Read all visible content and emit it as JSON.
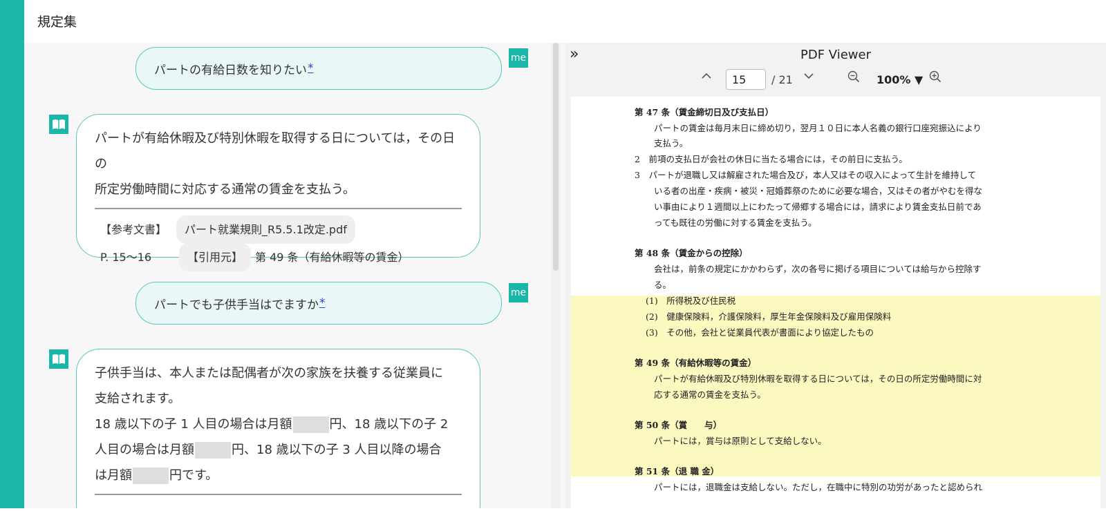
{
  "app": {
    "title": "規定集"
  },
  "chat": {
    "messages": [
      {
        "role": "user",
        "text": "パートの有給日数を知りたい",
        "mark": "*",
        "badge": "me"
      },
      {
        "role": "assistant",
        "lines": [
          "パートが有給休暇及び特別休暇を取得する日については，その日の",
          "所定労働時間に対応する通常の賃金を支払う。"
        ],
        "ref_label": "【参考文書】",
        "ref_file": "パート就業規則_R5.5.1改定.pdf",
        "pages": "P. 15〜16",
        "cite_label": "【引用元】",
        "cite_text": "第 49 条（有給休暇等の賃金）"
      },
      {
        "role": "user",
        "text": "パートでも子供手当はでますか",
        "mark": "*",
        "badge": "me"
      },
      {
        "role": "assistant",
        "line1": "子供手当は、本人または配偶者が次の家族を扶養する従業員に",
        "line2": "支給されます。",
        "l3a": "18 歳以下の子 1 人目の場合は月額",
        "l3b": "円、18 歳以下の子 2",
        "l4a": "人目の場合は月額",
        "l4b": "円、18 歳以下の子 3 人目以降の場合",
        "l5a": "は月額",
        "l5b": "円です。"
      }
    ]
  },
  "viewer": {
    "title": "PDF Viewer",
    "page": "15",
    "total": "/ 21",
    "zoom": "100%",
    "doc_lines": [
      "第 47 条（賃金締切日及び支払日）",
      "パートの賃金は毎月末日に締め切り，翌月１０日に本人名義の銀行口座宛振込により",
      "支払う。",
      "2　前項の支払日が会社の休日に当たる場合には，その前日に支払う。",
      "3　パートが退職し又は解雇された場合及び，本人又はその収入によって生計を維持して",
      "いる者の出産・疾病・被災・冠婚葬祭のために必要な場合，又はその者がやむを得な",
      "い事由により１週間以上にわたって帰郷する場合には，請求により賃金支払日前であ",
      "っても既往の労働に対する賃金を支払う。",
      "第 48 条（賃金からの控除）",
      "会社は，前条の規定にかかわらず，次の各号に掲げる項目については給与から控除す",
      "る。",
      "(1)　所得税及び住民税",
      "(2)　健康保険料，介護保険料，厚生年金保険料及び雇用保険料",
      "(3)　その他，会社と従業員代表が書面により協定したもの",
      "第 49 条（有給休暇等の賃金）",
      "パートが有給休暇及び特別休暇を取得する日については，その日の所定労働時間に対",
      "応する通常の賃金を支払う。",
      "第 50 条（賞　　与）",
      "パートには，賞与は原則として支給しない。",
      "第 51 条（退 職 金）",
      "パートには，退職金は支給しない。ただし，在職中に特別の功労があったと認められ"
    ]
  }
}
